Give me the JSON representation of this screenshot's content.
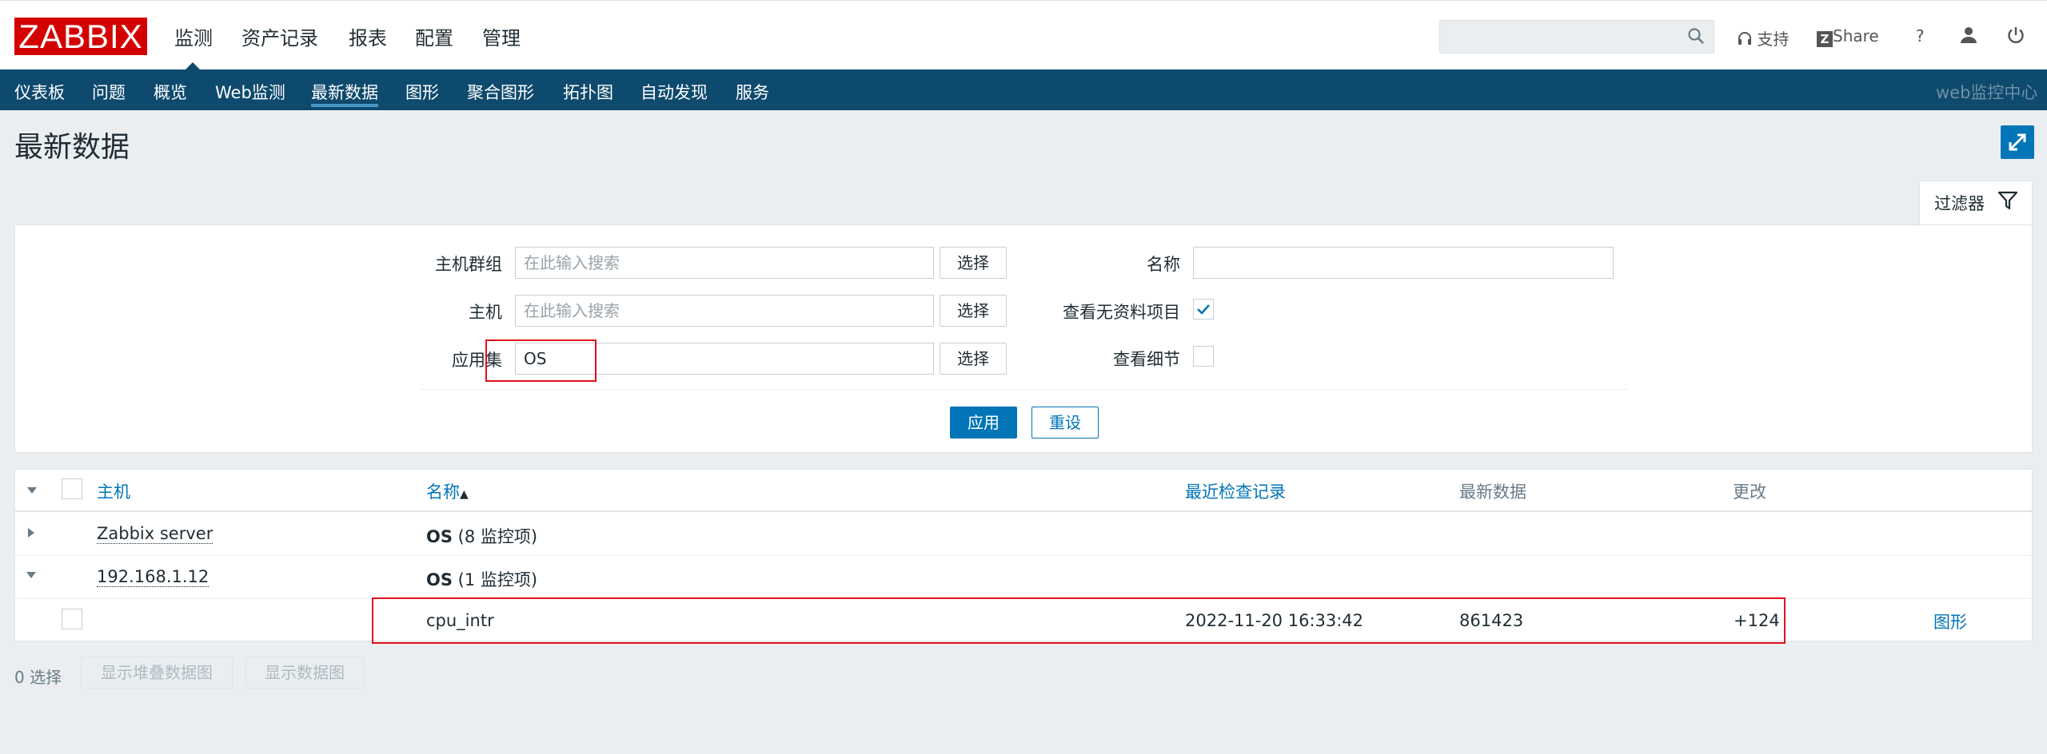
{
  "app": {
    "logo": "ZABBIX"
  },
  "main_menu": [
    "监测",
    "资产记录",
    "报表",
    "配置",
    "管理"
  ],
  "top_right": {
    "support": "支持",
    "share": "Share",
    "help": "?"
  },
  "sub_menu": [
    "仪表板",
    "问题",
    "概览",
    "Web监测",
    "最新数据",
    "图形",
    "聚合图形",
    "拓扑图",
    "自动发现",
    "服务"
  ],
  "sub_menu_active": "最新数据",
  "sub_menu_right": "web监控中心",
  "page_title": "最新数据",
  "filter": {
    "tab_label": "过滤器",
    "host_group_label": "主机群组",
    "host_group_placeholder": "在此输入搜索",
    "host_label": "主机",
    "host_placeholder": "在此输入搜索",
    "application_label": "应用集",
    "application_value": "OS",
    "select_button": "选择",
    "name_label": "名称",
    "name_value": "",
    "show_no_data_label": "查看无资料项目",
    "show_no_data_checked": true,
    "show_details_label": "查看细节",
    "show_details_checked": false,
    "apply_button": "应用",
    "reset_button": "重设"
  },
  "table": {
    "columns": {
      "host": "主机",
      "name": "名称",
      "last_check": "最近检查记录",
      "last_value": "最新数据",
      "change": "更改"
    },
    "sort_indicator": "▲",
    "groups": [
      {
        "host": "Zabbix server",
        "app": "OS",
        "count": "(8 监控项)",
        "expanded": false
      },
      {
        "host": "192.168.1.12",
        "app": "OS",
        "count": "(1 监控项)",
        "expanded": true
      }
    ],
    "item": {
      "name": "cpu_intr",
      "last_check": "2022-11-20 16:33:42",
      "last_value": "861423",
      "change": "+124",
      "graph_link": "图形"
    }
  },
  "footer": {
    "selected": "0 选择",
    "stacked_graph_button": "显示堆叠数据图",
    "graph_button": "显示数据图"
  }
}
